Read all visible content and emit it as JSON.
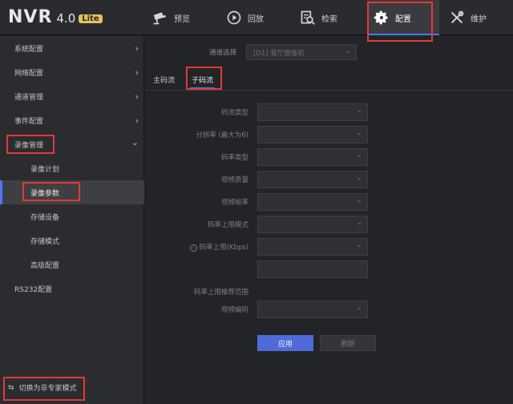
{
  "app": {
    "logo_text": "NVR",
    "version": "4.0",
    "badge": "Lite"
  },
  "nav": [
    {
      "label": "预览",
      "icon": "camera-icon"
    },
    {
      "label": "回放",
      "icon": "playback-icon"
    },
    {
      "label": "检索",
      "icon": "search-doc-icon"
    },
    {
      "label": "配置",
      "icon": "gear-icon",
      "active": true
    },
    {
      "label": "维护",
      "icon": "tools-icon"
    }
  ],
  "sidebar": {
    "items": [
      {
        "label": "系统配置",
        "chevron": "›"
      },
      {
        "label": "网络配置",
        "chevron": "›"
      },
      {
        "label": "通道管理",
        "chevron": "›"
      },
      {
        "label": "事件配置",
        "chevron": "›"
      },
      {
        "label": "录像管理",
        "chevron": "⌄",
        "expanded": true
      },
      {
        "label": "录像计划"
      },
      {
        "label": "录像参数",
        "selected": true
      },
      {
        "label": "存储设备"
      },
      {
        "label": "存储模式"
      },
      {
        "label": "高级配置"
      },
      {
        "label": "RS232配置"
      }
    ],
    "mode_switch": "切换为非专家模式",
    "mode_switch_icon": "⇆"
  },
  "channel": {
    "label": "通道选择",
    "value": "[D1] 客厅摄像机"
  },
  "tabs": [
    {
      "label": "主码流"
    },
    {
      "label": "子码流",
      "active": true
    }
  ],
  "form": [
    {
      "label": "码流类型",
      "type": "select",
      "value": ""
    },
    {
      "label": "分辨率 (最大为6)",
      "type": "select",
      "value": ""
    },
    {
      "label": "码率类型",
      "type": "select",
      "value": ""
    },
    {
      "label": "视频质量",
      "type": "select",
      "value": ""
    },
    {
      "label": "视频帧率",
      "type": "select",
      "value": ""
    },
    {
      "label": "码率上限模式",
      "type": "select",
      "value": ""
    },
    {
      "label": "码率上限(Kbps)",
      "type": "select",
      "value": "",
      "info": true
    },
    {
      "label": "",
      "type": "input",
      "value": ""
    },
    {
      "label": "码率上限推荐范围",
      "type": "text",
      "value": ""
    },
    {
      "label": "视频编码",
      "type": "select",
      "value": ""
    }
  ],
  "buttons": {
    "apply": "应用",
    "refresh": "刷新"
  },
  "colors": {
    "accent": "#4e78ff",
    "highlight": "#e53935",
    "apply_button": "#4e6bd9"
  }
}
